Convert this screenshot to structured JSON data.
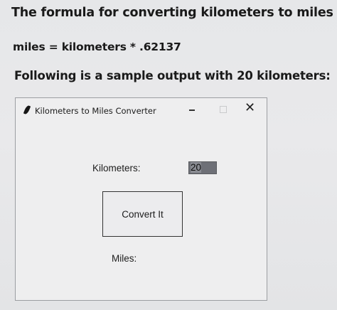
{
  "instructions": {
    "line1": "The formula for converting kilometers to miles is",
    "line2": "miles = kilometers * .62137",
    "line3": "Following is a sample output with 20 kilometers:"
  },
  "window": {
    "title": "Kilometers to Miles Converter",
    "minimize_glyph": "–",
    "close_glyph": "✕",
    "app_icon": "feather-icon"
  },
  "form": {
    "km_label": "Kilometers:",
    "km_value": "20",
    "convert_label": "Convert It",
    "miles_label": "Miles:"
  }
}
